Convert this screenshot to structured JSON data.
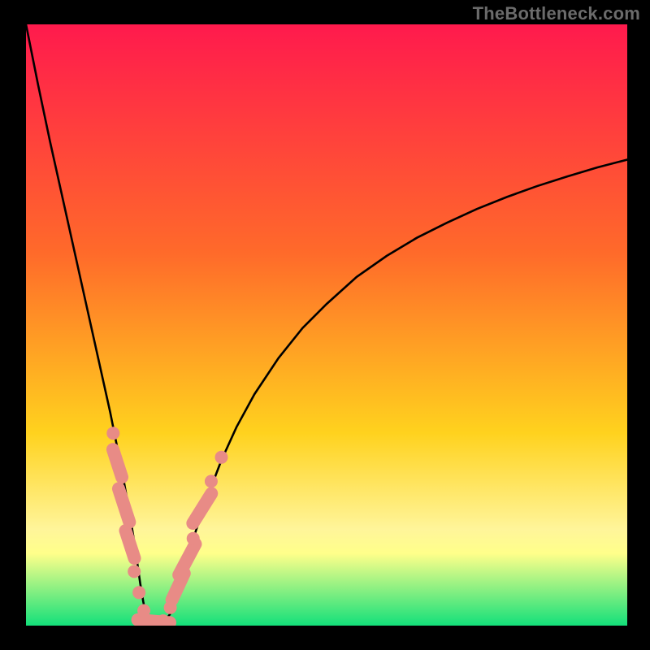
{
  "watermark": "TheBottleneck.com",
  "colors": {
    "frame": "#000000",
    "curve": "#000000",
    "markers": "#e88b86",
    "gradient_top": "#ff1a4d",
    "gradient_mid1": "#ff6a2a",
    "gradient_mid2": "#ffd21e",
    "gradient_yellowband": "#fff59a",
    "gradient_green": "#13e07a"
  },
  "chart_data": {
    "type": "line",
    "title": "",
    "xlabel": "",
    "ylabel": "",
    "xlim": [
      0,
      100
    ],
    "ylim": [
      0,
      100
    ],
    "curve": {
      "x": [
        0.0,
        2.0,
        4.0,
        6.0,
        8.0,
        10.0,
        12.0,
        13.0,
        14.0,
        15.0,
        16.0,
        17.0,
        18.0,
        18.5,
        19.0,
        19.5,
        20.0,
        20.5,
        21.0,
        22.0,
        23.0,
        24.0,
        25.0,
        26.0,
        28.0,
        30.0,
        32.5,
        35.0,
        38.0,
        42.0,
        46.0,
        50.0,
        55.0,
        60.0,
        65.0,
        70.0,
        75.0,
        80.0,
        85.0,
        90.0,
        95.0,
        100.0
      ],
      "y": [
        100.0,
        90.0,
        80.5,
        71.5,
        62.5,
        53.5,
        44.5,
        40.0,
        35.5,
        30.5,
        25.5,
        20.0,
        14.0,
        10.5,
        7.0,
        4.0,
        1.5,
        0.3,
        0.0,
        0.0,
        0.5,
        2.0,
        5.0,
        8.5,
        15.0,
        21.0,
        27.5,
        33.0,
        38.5,
        44.5,
        49.5,
        53.5,
        58.0,
        61.5,
        64.5,
        67.0,
        69.3,
        71.3,
        73.1,
        74.7,
        76.2,
        77.5
      ]
    },
    "markers": [
      {
        "x": 14.5,
        "y": 32.0,
        "shape": "circle"
      },
      {
        "x": 15.2,
        "y": 27.0,
        "shape": "capsule",
        "angle": 72,
        "len": 7
      },
      {
        "x": 16.3,
        "y": 20.0,
        "shape": "capsule",
        "angle": 72,
        "len": 8
      },
      {
        "x": 17.3,
        "y": 13.5,
        "shape": "capsule",
        "angle": 72,
        "len": 7
      },
      {
        "x": 18.0,
        "y": 9.0,
        "shape": "circle"
      },
      {
        "x": 18.8,
        "y": 5.5,
        "shape": "circle"
      },
      {
        "x": 19.6,
        "y": 2.5,
        "shape": "circle"
      },
      {
        "x": 20.5,
        "y": 0.8,
        "shape": "capsule",
        "angle": 5,
        "len": 6
      },
      {
        "x": 21.5,
        "y": 0.5,
        "shape": "capsule",
        "angle": 0,
        "len": 7
      },
      {
        "x": 22.8,
        "y": 0.8,
        "shape": "circle"
      },
      {
        "x": 24.0,
        "y": 3.0,
        "shape": "circle"
      },
      {
        "x": 25.3,
        "y": 6.5,
        "shape": "capsule",
        "angle": -65,
        "len": 7
      },
      {
        "x": 26.8,
        "y": 11.0,
        "shape": "capsule",
        "angle": -62,
        "len": 8
      },
      {
        "x": 27.8,
        "y": 14.5,
        "shape": "circle"
      },
      {
        "x": 29.3,
        "y": 19.5,
        "shape": "capsule",
        "angle": -58,
        "len": 8
      },
      {
        "x": 30.8,
        "y": 24.0,
        "shape": "circle"
      },
      {
        "x": 32.5,
        "y": 28.0,
        "shape": "circle"
      }
    ]
  }
}
